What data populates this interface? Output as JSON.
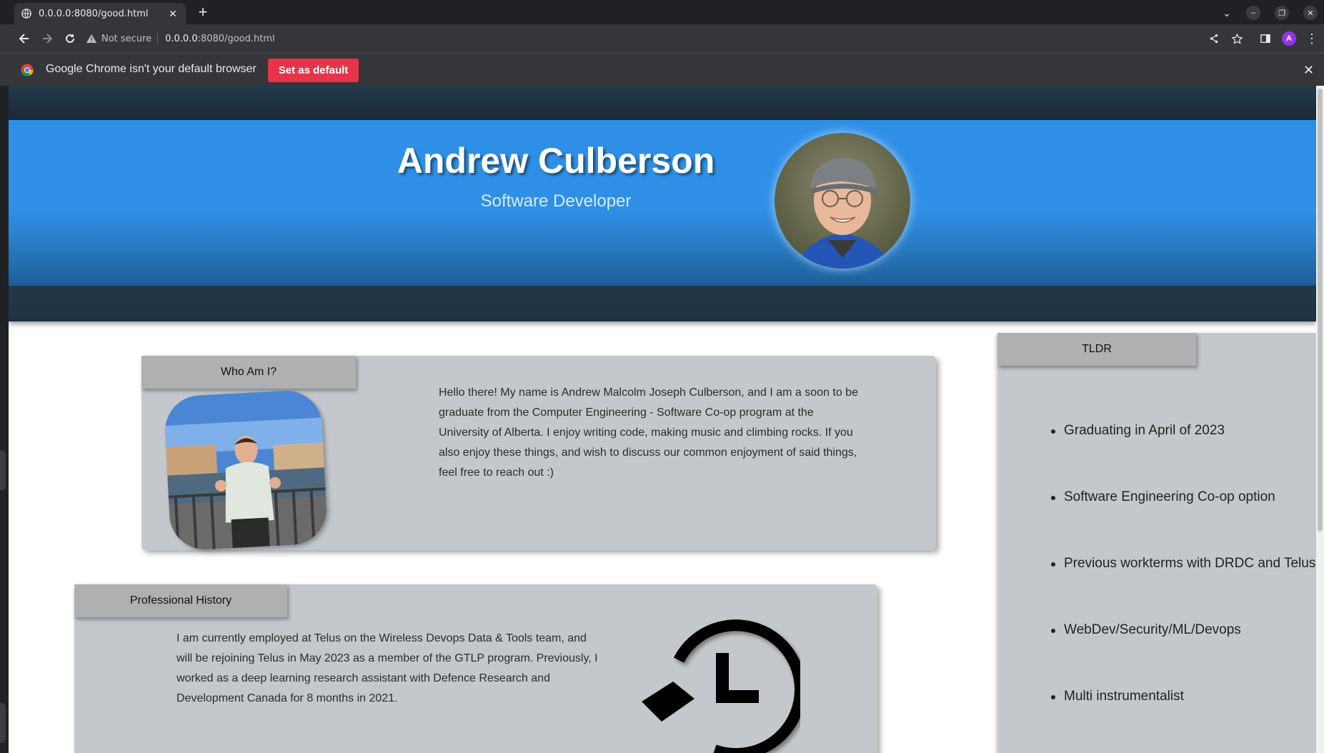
{
  "browser": {
    "tab_title": "0.0.0.0:8080/good.html",
    "not_secure_label": "Not secure",
    "url_host": "0.0.0.0",
    "url_path": ":8080/good.html",
    "profile_initial": "A",
    "infobar_text": "Google Chrome isn't your default browser",
    "set_default_label": "Set as default"
  },
  "hero": {
    "name": "Andrew Culberson",
    "role": "Software Developer"
  },
  "who_am_i": {
    "title": "Who Am I?",
    "body": "Hello there! My name is Andrew Malcolm Joseph Culberson, and I am a soon to be graduate from the Computer Engineering - Software Co-op program at the University of Alberta. I enjoy writing code, making music and climbing rocks. If you also enjoy these things, and wish to discuss our common enjoyment of said things, feel free to reach out :)"
  },
  "professional_history": {
    "title": "Professional History",
    "body": "I am currently employed at Telus on the Wireless Devops Data & Tools team, and will be rejoining Telus in May 2023 as a member of the GTLP program. Previously, I worked as a deep learning research assistant with Defence Research and Development Canada for 8 months in 2021."
  },
  "tldr": {
    "title": "TLDR",
    "items": [
      "Graduating in April of 2023",
      "Software Engineering Co-op option",
      "Previous workterms with DRDC and Telus",
      "WebDev/Security/ML/Devops",
      "Multi instrumentalist"
    ]
  },
  "colors": {
    "hero_blue": "#2f8fe6",
    "dark_band": "#1f3342",
    "card_grey": "#c4c8cc",
    "set_default_red": "#e8344a"
  }
}
